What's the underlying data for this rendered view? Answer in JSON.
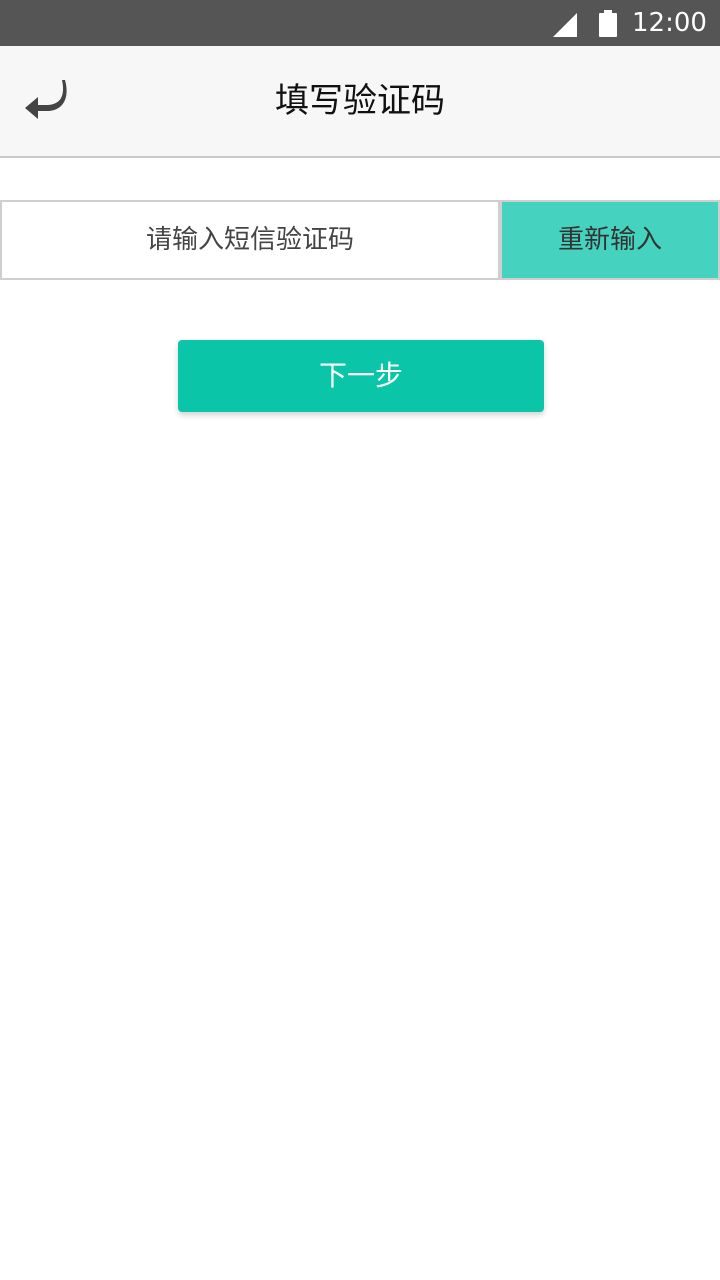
{
  "status_bar": {
    "time": "12:00",
    "signal_icon": "signal-icon",
    "battery_icon": "battery-icon"
  },
  "app_bar": {
    "title": "填写验证码",
    "back_icon": "back-arrow-icon"
  },
  "form": {
    "code_placeholder": "请输入短信验证码",
    "code_value": "",
    "reenter_label": "重新输入",
    "next_label": "下一步"
  },
  "colors": {
    "status_bar": "#555555",
    "app_bar": "#f7f7f7",
    "reenter_button": "#45d3bf",
    "next_button": "#0ac5a8"
  }
}
